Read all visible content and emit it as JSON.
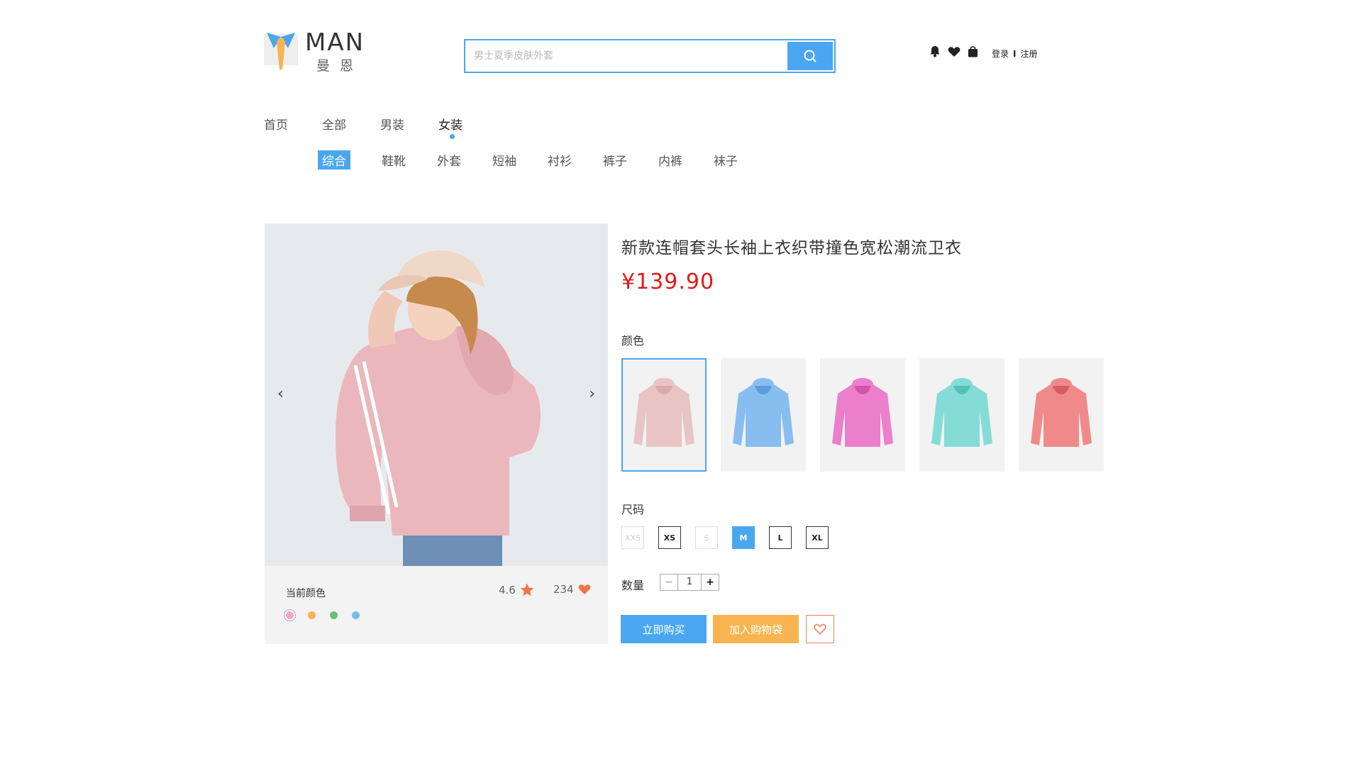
{
  "brand": {
    "name": "MAN",
    "subtitle": "曼恩"
  },
  "search": {
    "placeholder": "男士夏季皮肤外套"
  },
  "header": {
    "login": "登录",
    "separator": "I",
    "register": "注册"
  },
  "nav": {
    "main": [
      "首页",
      "全部",
      "男装",
      "女装"
    ],
    "main_active_index": 3,
    "sub": [
      "综合",
      "鞋靴",
      "外套",
      "短袖",
      "衬衫",
      "裤子",
      "内裤",
      "袜子"
    ],
    "sub_active_index": 0
  },
  "gallery": {
    "prev": "‹",
    "next": "›",
    "current_color_label": "当前颜色",
    "rating": "4.6",
    "likes": "234",
    "color_dots": [
      "#f4a7b9",
      "#f7b451",
      "#6cc07a",
      "#6fbfea"
    ]
  },
  "product": {
    "title": "新款连帽套头长袖上衣织带撞色宽松潮流卫衣",
    "price": "¥139.90",
    "color_label": "颜色",
    "swatch_colors": [
      "#e8c4c4",
      "#88bdf0",
      "#ec7fcc",
      "#85dcd6",
      "#f08a8a"
    ],
    "selected_swatch": 0,
    "size_label": "尺码",
    "sizes": [
      "XXS",
      "XS",
      "S",
      "M",
      "L",
      "XL"
    ],
    "disabled_sizes": [
      "XXS",
      "S"
    ],
    "selected_size": "M",
    "quantity_label": "数量",
    "quantity": "1",
    "minus": "−",
    "plus": "+",
    "buy_now": "立即购买",
    "add_to_bag": "加入购物袋"
  },
  "colors": {
    "accent": "#4aa7ef",
    "price": "#e01a1a",
    "cart": "#f7b451",
    "fav": "#f07f57"
  }
}
